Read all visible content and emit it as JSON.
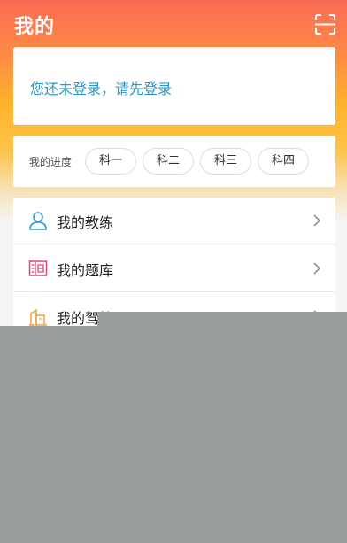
{
  "header": {
    "title": "我的",
    "scan_icon": "scan-icon"
  },
  "login": {
    "prompt": "您还未登录，请先登录"
  },
  "progress": {
    "label": "我的进度",
    "subjects": [
      "科一",
      "科二",
      "科三",
      "科四"
    ]
  },
  "menu": {
    "items": [
      {
        "label": "我的教练",
        "icon": "coach-person-icon",
        "icon_color": "#2a97c9"
      },
      {
        "label": "我的题库",
        "icon": "question-bank-icon",
        "icon_color": "#d9467a"
      },
      {
        "label": "我的驾校",
        "icon": "driving-school-building-icon",
        "icon_color": "#f0a03c"
      }
    ],
    "arrow_icon": "chevron-right-icon"
  },
  "colors": {
    "header_gradient_top": "#fb6a55",
    "header_gradient_mid": "#fdb42c",
    "accent_text": "#2a97c9",
    "overlay_gray": "#999c9d"
  }
}
